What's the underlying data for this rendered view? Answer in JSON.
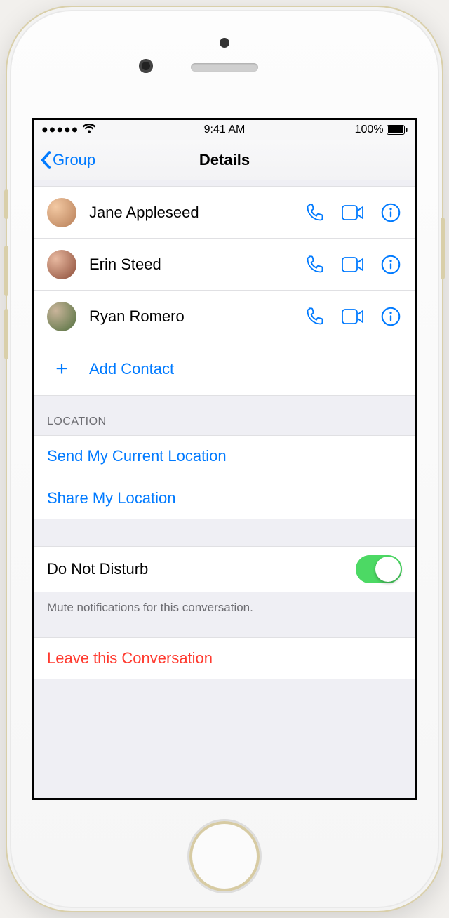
{
  "status": {
    "time": "9:41 AM",
    "battery": "100%"
  },
  "navbar": {
    "back_label": "Group",
    "title": "Details"
  },
  "contacts": [
    {
      "name": "Jane Appleseed"
    },
    {
      "name": "Erin Steed"
    },
    {
      "name": "Ryan Romero"
    }
  ],
  "add_contact_label": "Add Contact",
  "location": {
    "header": "LOCATION",
    "send_current": "Send My Current Location",
    "share": "Share My Location"
  },
  "dnd": {
    "label": "Do Not Disturb",
    "note": "Mute notifications for this conversation.",
    "on": true
  },
  "leave_label": "Leave this Conversation"
}
